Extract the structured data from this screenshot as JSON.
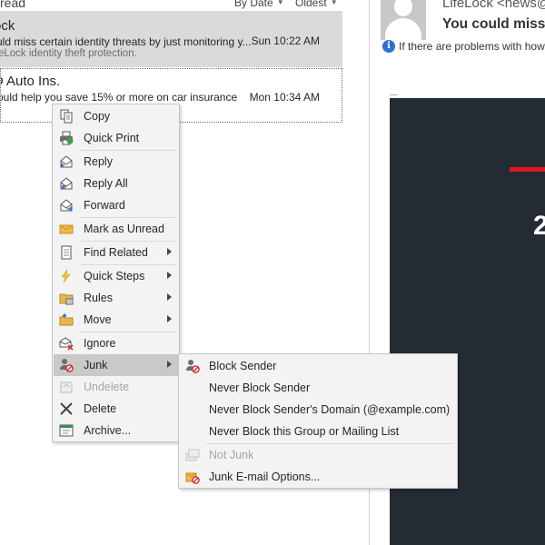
{
  "list_header": {
    "filter_label": "read",
    "sort_by": "By Date",
    "sort_order": "Oldest"
  },
  "messages": [
    {
      "sender": "ock",
      "subject": "uld miss certain identity threats by just monitoring y...",
      "preview": "eLock identity theft protection.",
      "time": "Sun 10:22 AM"
    },
    {
      "sender": "O Auto Ins.",
      "subject": "ould help you save 15% or more on car insurance",
      "preview": "",
      "time": "Mon 10:34 AM"
    }
  ],
  "reading_pane": {
    "from": "LifeLock <news@",
    "subject": "You could miss c",
    "info_text": "If there are problems with how",
    "body_number": "2"
  },
  "context_menu": {
    "items": [
      {
        "label": "Copy",
        "icon": "copy-icon"
      },
      {
        "label": "Quick Print",
        "icon": "quick-print-icon"
      },
      {
        "label": "Reply",
        "icon": "reply-icon"
      },
      {
        "label": "Reply All",
        "icon": "reply-all-icon"
      },
      {
        "label": "Forward",
        "icon": "forward-icon"
      },
      {
        "label": "Mark as Unread",
        "icon": "envelope-icon"
      },
      {
        "label": "Find Related",
        "icon": "find-related-icon"
      },
      {
        "label": "Quick Steps",
        "icon": "lightning-icon"
      },
      {
        "label": "Rules",
        "icon": "rules-icon"
      },
      {
        "label": "Move",
        "icon": "move-folder-icon"
      },
      {
        "label": "Ignore",
        "icon": "ignore-icon"
      },
      {
        "label": "Junk",
        "icon": "junk-icon"
      },
      {
        "label": "Undelete",
        "icon": "undelete-icon"
      },
      {
        "label": "Delete",
        "icon": "delete-x-icon"
      },
      {
        "label": "Archive...",
        "icon": "archive-icon"
      }
    ]
  },
  "junk_submenu": {
    "items": [
      {
        "label": "Block Sender",
        "icon": "block-sender-icon"
      },
      {
        "label": "Never Block Sender"
      },
      {
        "label": "Never Block Sender's Domain (@example.com)"
      },
      {
        "label": "Never Block this Group or Mailing List"
      },
      {
        "label": "Not Junk",
        "icon": "not-junk-icon"
      },
      {
        "label": "Junk E-mail Options...",
        "icon": "junk-options-icon"
      }
    ]
  },
  "colors": {
    "selected_row": "#dadada",
    "menu_bg": "#f3f3f3",
    "menu_highlight": "#c9c9c9",
    "email_body_bg": "#242b33",
    "accent_red": "#e3161f",
    "info_blue": "#2f6fd0"
  }
}
